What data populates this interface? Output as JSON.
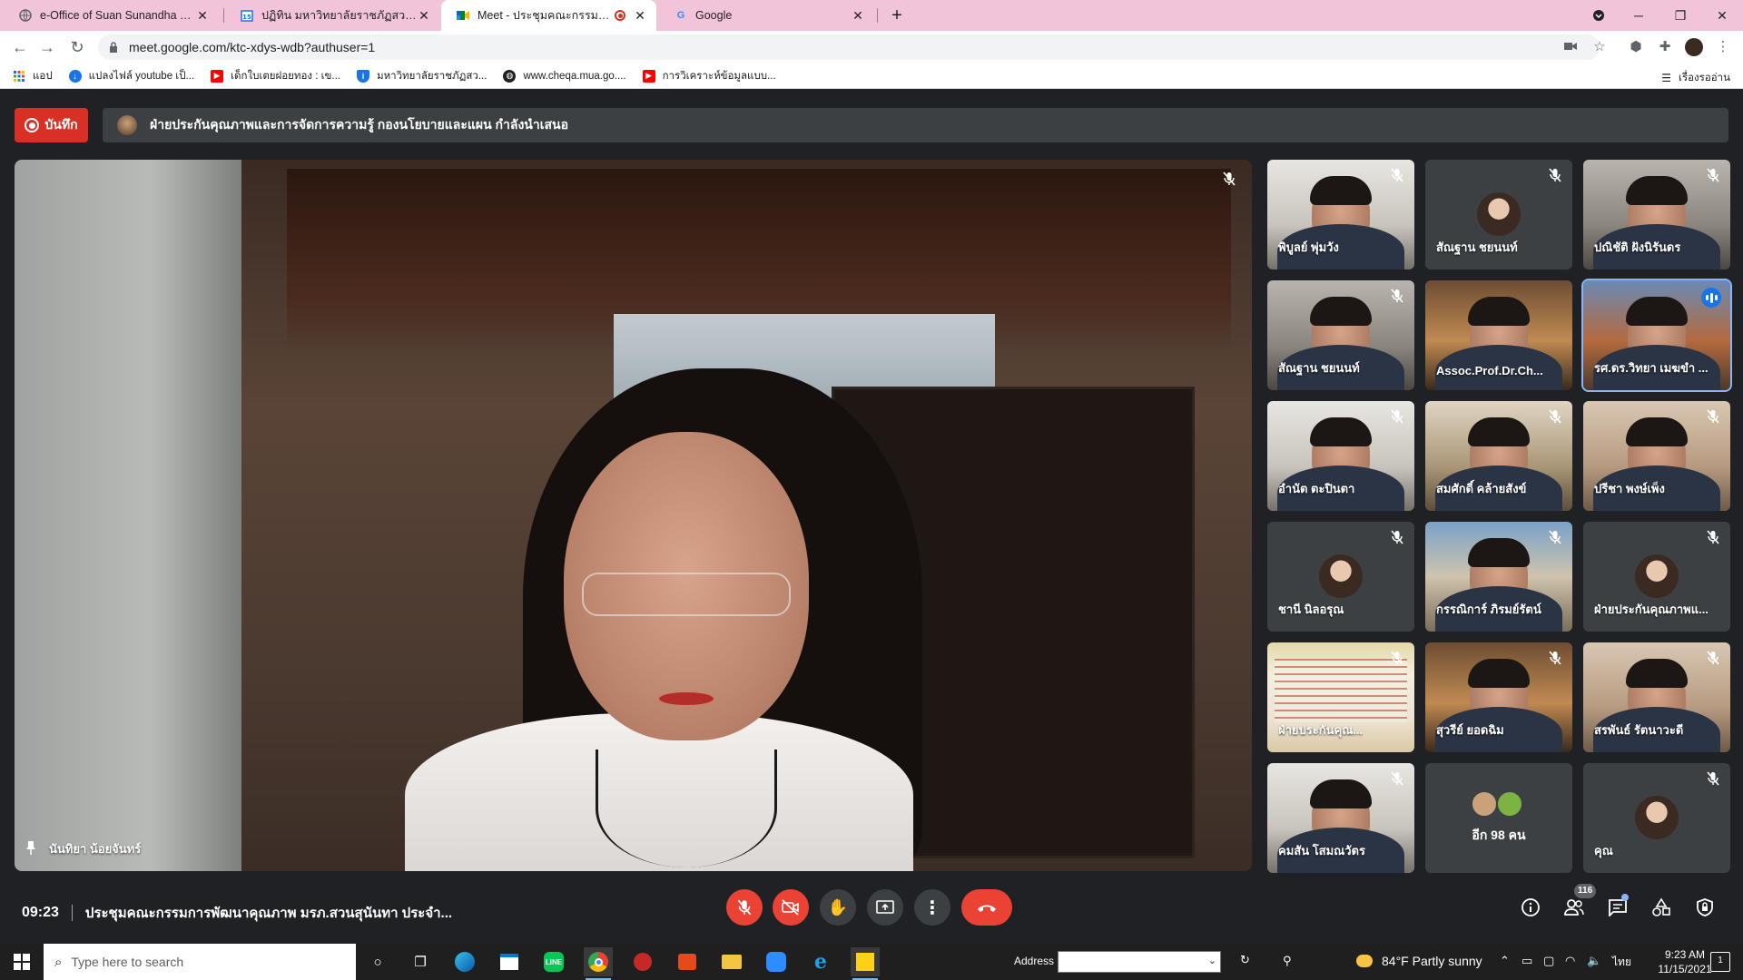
{
  "browser": {
    "tabs": [
      {
        "title": "e-Office of Suan Sunandha Rajab",
        "icon": "globe-icon",
        "active": false
      },
      {
        "title": "ปฏิทิน มหาวิทยาลัยราชภัฏสวนสุนันทา",
        "icon": "calendar-icon",
        "active": false
      },
      {
        "title": "Meet - ประชุมคณะกรรมการพัฒนา",
        "icon": "meet-icon",
        "active": true
      },
      {
        "title": "Google",
        "icon": "google-icon",
        "active": false
      }
    ],
    "url": "meet.google.com/ktc-xdys-wdb?authuser=1",
    "bookmarks": [
      {
        "label": "แอป",
        "icon": "apps-grid-icon",
        "color": "#5f6368"
      },
      {
        "label": "แปลงไฟล์ youtube เป็...",
        "icon": "download-circle-icon",
        "color": "#1a73e8"
      },
      {
        "label": "เด็กใบเตยฝอยทอง : เข...",
        "icon": "youtube-icon",
        "color": "#ff0000"
      },
      {
        "label": "มหาวิทยาลัยราชภัฏสว...",
        "icon": "shield-icon",
        "color": "#1a73e8"
      },
      {
        "label": "www.cheqa.mua.go....",
        "icon": "globe-icon",
        "color": "#202124"
      },
      {
        "label": "การวิเคราะห์ข้อมูลแบบ...",
        "icon": "youtube-icon",
        "color": "#ff0000"
      }
    ],
    "reading_list": "เรื่องรออ่าน"
  },
  "meet": {
    "record_label": "บันทึก",
    "presenter_banner": "ฝ่ายประกันคุณภาพและการจัดการความรู้ กองนโยบายและแผน กำลังนำเสนอ",
    "main_speaker": "นันทิยา น้อยจันทร์",
    "tiles": [
      {
        "name": "พิบูลย์ พุ่มวัง",
        "bg": "bg-office",
        "mode": "video",
        "muted": true
      },
      {
        "name": "สัณฐาน ชยนนท์",
        "bg": "",
        "mode": "avatar",
        "muted": true
      },
      {
        "name": "ปณิชัติ ฝังนิรันดร",
        "bg": "bg-room",
        "mode": "video",
        "muted": true
      },
      {
        "name": "สัณฐาน ชยนนท์",
        "bg": "bg-room",
        "mode": "video",
        "muted": true
      },
      {
        "name": "Assoc.Prof.Dr.Ch...",
        "bg": "bg-palace",
        "mode": "video",
        "muted": false
      },
      {
        "name": "รศ.ดร.วิทยา เมฆขำ ...",
        "bg": "bg-palace2",
        "mode": "video",
        "muted": false,
        "speaking": true
      },
      {
        "name": "อำนัต ตะปินตา",
        "bg": "bg-office",
        "mode": "video",
        "muted": true
      },
      {
        "name": "สมศักดิ์ คล้ายสังข์",
        "bg": "bg-shelf",
        "mode": "video",
        "muted": true
      },
      {
        "name": "ปรีชา พงษ์เพ็ง",
        "bg": "bg-temple",
        "mode": "video",
        "muted": true
      },
      {
        "name": "ชานี นิลอรุณ",
        "bg": "",
        "mode": "avatar",
        "muted": true
      },
      {
        "name": "กรรณิการ์ ภิรมย์รัตน์",
        "bg": "bg-building",
        "mode": "video",
        "muted": true
      },
      {
        "name": "ฝ่ายประกันคุณภาพแ...",
        "bg": "",
        "mode": "avatar",
        "muted": true
      },
      {
        "name": "ฝ่ายประกันคุณ...",
        "bg": "bg-slide",
        "mode": "slide",
        "muted": true
      },
      {
        "name": "สุวรีย์ ยอดฉิม",
        "bg": "bg-palace",
        "mode": "video",
        "muted": true
      },
      {
        "name": "สรพันธ์ รัตนาวะดี",
        "bg": "bg-temple",
        "mode": "video",
        "muted": true
      },
      {
        "name": "คมสัน โสมณวัตร",
        "bg": "bg-office",
        "mode": "video",
        "muted": true
      },
      {
        "name": "",
        "bg": "",
        "mode": "more",
        "muted": false,
        "more_label": "อีก 98 คน"
      },
      {
        "name": "คุณ",
        "bg": "",
        "mode": "avatar",
        "muted": true
      }
    ],
    "time": "09:23",
    "meeting_title": "ประชุมคณะกรรมการพัฒนาคุณภาพ มรภ.สวนสุนันทา ประจำ...",
    "participants_count": "116",
    "colors": {
      "end_call": "#ea4335",
      "accent": "#8ab4f8",
      "record": "#d93025"
    }
  },
  "taskbar": {
    "search_placeholder": "Type here to search",
    "address_label": "Address",
    "weather": "84°F  Partly sunny",
    "language": "ไทย",
    "time": "9:23 AM",
    "date": "11/15/2021",
    "notifications": "1"
  }
}
